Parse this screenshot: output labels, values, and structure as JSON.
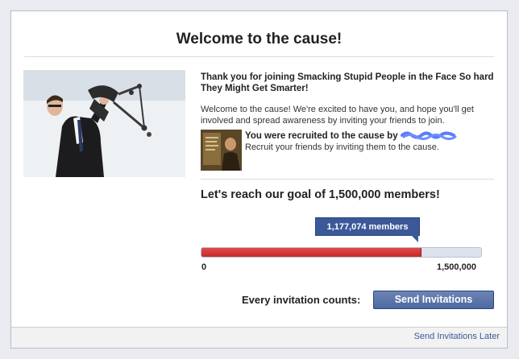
{
  "dialog": {
    "title": "Welcome to the cause!",
    "thank_you": "Thank you for joining Smacking Stupid People in the Face So hard They Might Get Smarter!",
    "welcome_text": "Welcome to the cause! We're excited to have you, and hope you'll get involved and spread awareness by inviting your friends to join.",
    "recruited_label": "You were recruited to the cause by",
    "recruit_sub": "Recruit your friends by inviting them to the cause.",
    "goal_text": "Let's reach our goal of 1,500,000 members!",
    "members_badge": "1,177,074 members",
    "progress": {
      "current": 1177074,
      "goal": 1500000,
      "min_label": "0",
      "max_label": "1,500,000"
    },
    "invite_label": "Every invitation counts:",
    "send_button": "Send Invitations",
    "later_link": "Send Invitations Later"
  },
  "colors": {
    "facebook_blue": "#3b5998",
    "progress_red": "#d23a3a",
    "scribble_blue": "#5a7bff"
  }
}
